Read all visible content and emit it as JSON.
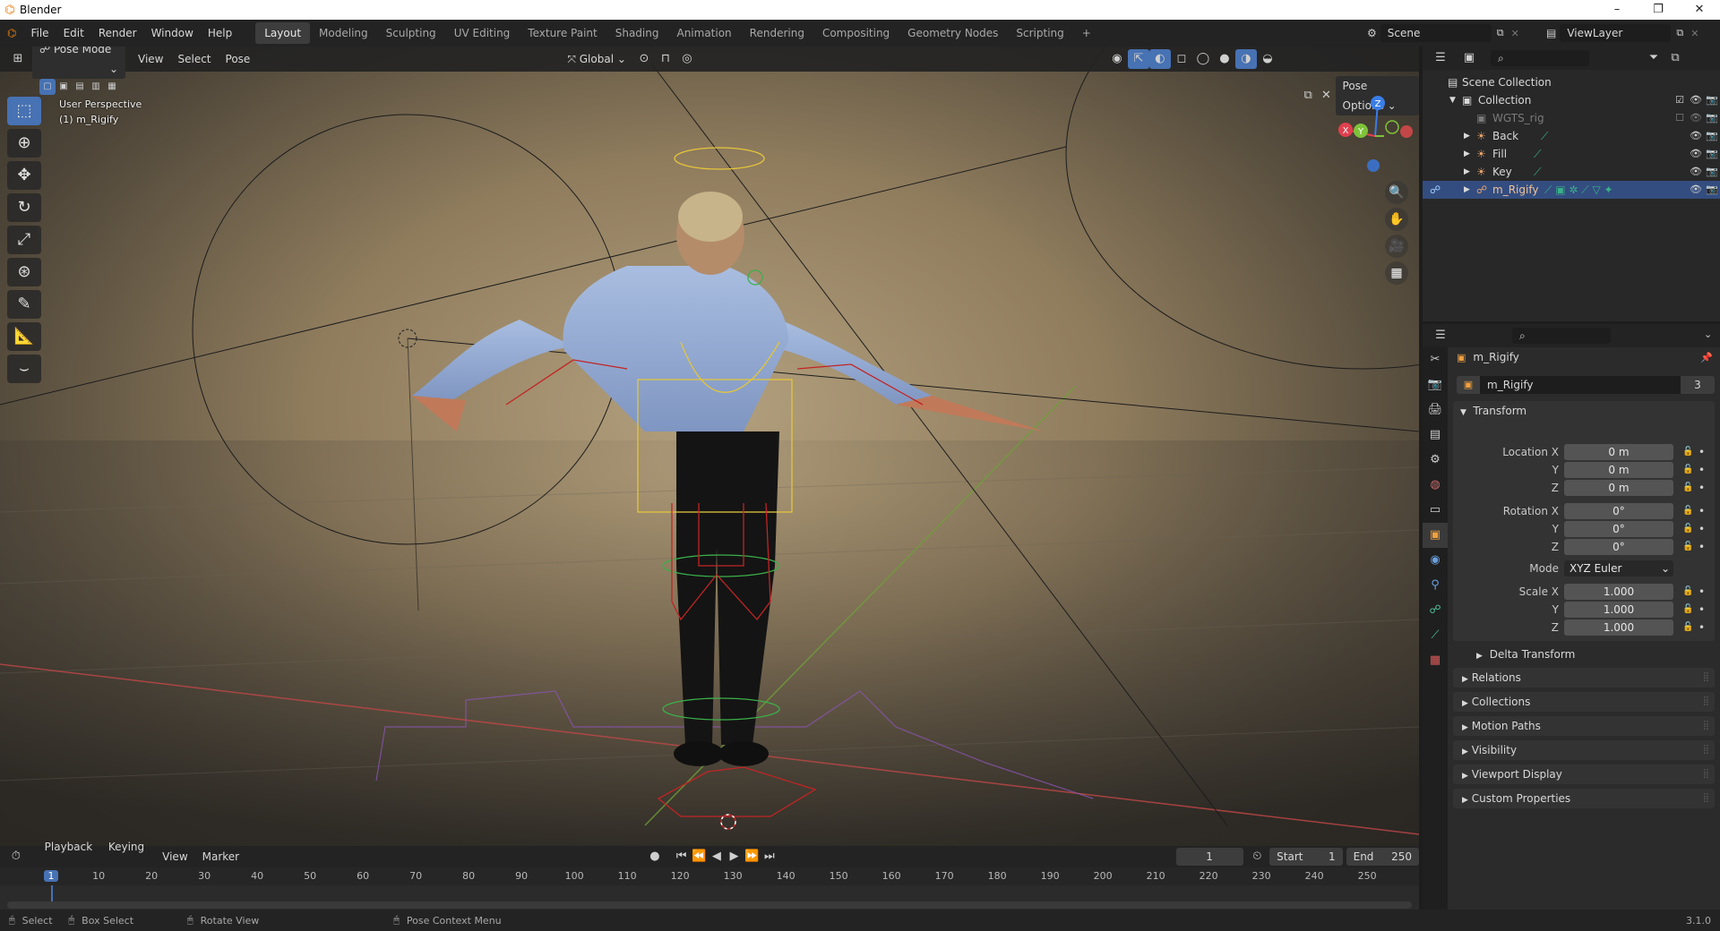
{
  "app": {
    "title": "Blender",
    "version": "3.1.0"
  },
  "menu": {
    "items": [
      "File",
      "Edit",
      "Render",
      "Window",
      "Help"
    ]
  },
  "workspaces": [
    "Layout",
    "Modeling",
    "Sculpting",
    "UV Editing",
    "Texture Paint",
    "Shading",
    "Animation",
    "Rendering",
    "Compositing",
    "Geometry Nodes",
    "Scripting"
  ],
  "active_workspace": "Layout",
  "scene": {
    "name": "Scene",
    "view_layer": "ViewLayer"
  },
  "viewport": {
    "mode": "Pose Mode",
    "menus": [
      "View",
      "Select",
      "Pose"
    ],
    "orientation": "Global",
    "pose_options": "Pose Options",
    "perspective_label": "User Perspective",
    "object_label": "(1) m_Rigify",
    "gizmo": {
      "x": "X",
      "y": "Y",
      "z": "Z"
    }
  },
  "timeline": {
    "menus": [
      "Playback",
      "Keying",
      "View",
      "Marker"
    ],
    "current_frame": "1",
    "start_label": "Start",
    "start": "1",
    "end_label": "End",
    "end": "250",
    "ruler": [
      "1",
      "10",
      "20",
      "30",
      "40",
      "50",
      "60",
      "70",
      "80",
      "90",
      "100",
      "110",
      "120",
      "130",
      "140",
      "150",
      "160",
      "170",
      "180",
      "190",
      "200",
      "210",
      "220",
      "230",
      "240",
      "250"
    ]
  },
  "statusbar": {
    "items": [
      "Select",
      "Box Select",
      "Rotate View",
      "Pose Context Menu"
    ]
  },
  "outliner": {
    "rows": [
      {
        "name": "Scene Collection"
      },
      {
        "name": "Collection"
      },
      {
        "name": "WGTS_rig"
      },
      {
        "name": "Back"
      },
      {
        "name": "Fill"
      },
      {
        "name": "Key"
      },
      {
        "name": "m_Rigify"
      }
    ]
  },
  "properties": {
    "object_name": "m_Rigify",
    "datablock_name": "m_Rigify",
    "users": "3",
    "transform_label": "Transform",
    "location": {
      "label_x": "Location X",
      "label_y": "Y",
      "label_z": "Z",
      "x": "0 m",
      "y": "0 m",
      "z": "0 m"
    },
    "rotation": {
      "label_x": "Rotation X",
      "label_y": "Y",
      "label_z": "Z",
      "x": "0°",
      "y": "0°",
      "z": "0°"
    },
    "mode_label": "Mode",
    "mode_value": "XYZ Euler",
    "scale": {
      "label_x": "Scale X",
      "label_y": "Y",
      "label_z": "Z",
      "x": "1.000",
      "y": "1.000",
      "z": "1.000"
    },
    "delta_transform": "Delta Transform",
    "panels": [
      "Relations",
      "Collections",
      "Motion Paths",
      "Visibility",
      "Viewport Display",
      "Custom Properties"
    ]
  },
  "colors": {
    "accent": "#4772b3",
    "selection": "#334d80",
    "x_axis": "#e0404e",
    "y_axis": "#7ec23a",
    "z_axis": "#3b7de8"
  }
}
